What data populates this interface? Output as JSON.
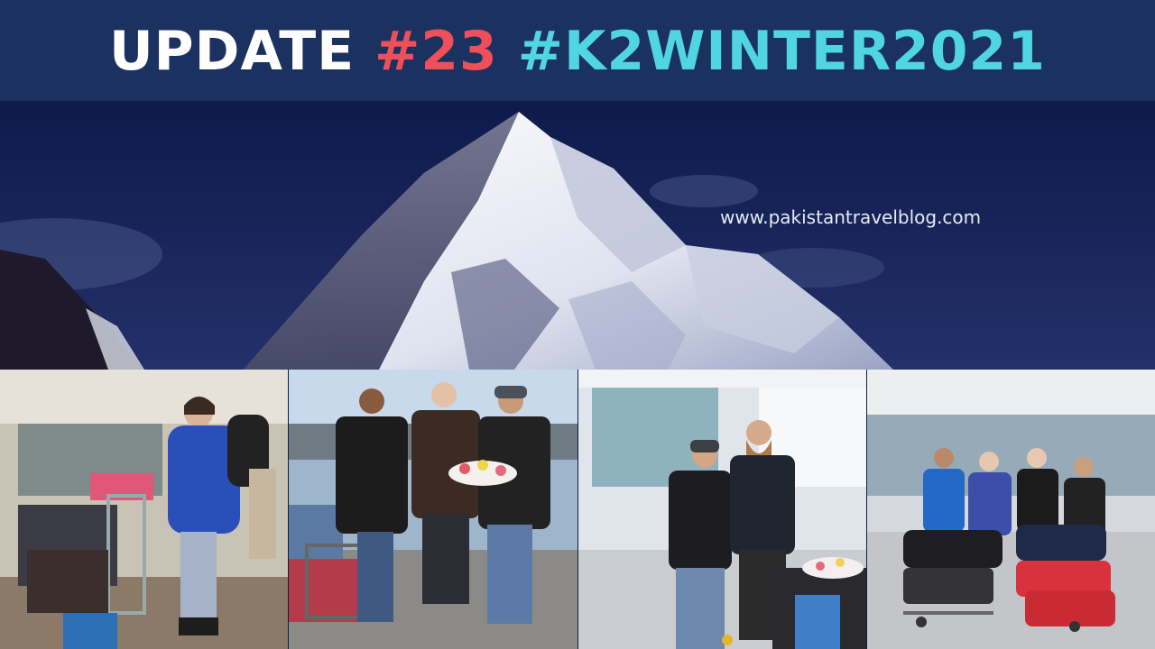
{
  "header": {
    "word_update": "UPDATE",
    "word_number": "#23",
    "word_hashtag": "#K2WINTER2021",
    "colors": {
      "banner": "#1b3261",
      "white": "#ffffff",
      "number": "#ef4f59",
      "hashtag": "#4fd6e2"
    }
  },
  "hero": {
    "subject": "snow-covered mountain peak against night-blue sky",
    "url": "www.pakistantravelblog.com"
  },
  "photos": [
    {
      "subject": "climber in blue down jacket with luggage carts at airport arrivals"
    },
    {
      "subject": "three men outdoors, one holding flowers, luggage cart beside them"
    },
    {
      "subject": "two men in airport terminal, flowers on luggage cart"
    },
    {
      "subject": "group of four climbers with red duffel bags on trolleys in airport hall"
    }
  ]
}
